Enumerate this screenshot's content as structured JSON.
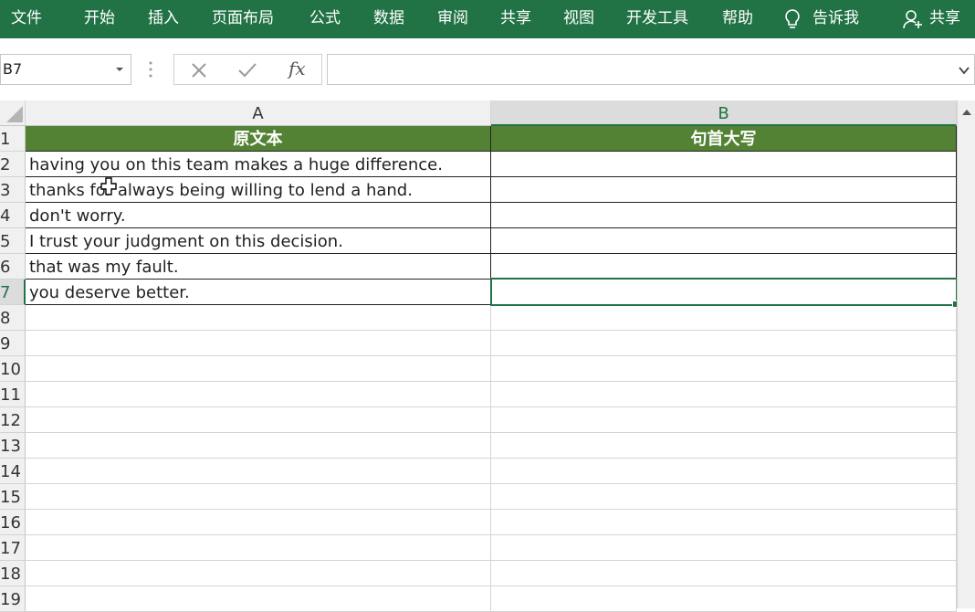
{
  "ribbon": {
    "tabs": [
      "文件",
      "开始",
      "插入",
      "页面布局",
      "公式",
      "数据",
      "审阅",
      "共享",
      "视图",
      "开发工具",
      "帮助"
    ],
    "tell_me": "告诉我",
    "share": "共享",
    "color": "#217346"
  },
  "formula_bar": {
    "name_box": "B7",
    "cancel_icon": "x-icon",
    "enter_icon": "check-icon",
    "function_label": "fx",
    "formula": ""
  },
  "sheet": {
    "columns": [
      "A",
      "B"
    ],
    "selected_column": "B",
    "rows": [
      "1",
      "2",
      "3",
      "4",
      "5",
      "6",
      "7",
      "8",
      "9",
      "10",
      "11",
      "12",
      "13",
      "14",
      "15",
      "16",
      "17",
      "18",
      "19"
    ],
    "selected_row": "7",
    "header_row": [
      "原文本",
      "句首大写"
    ],
    "header_fill": "#548235",
    "data": [
      [
        "having you on this team makes a huge difference.",
        ""
      ],
      [
        "thanks for always being willing to lend a hand.",
        ""
      ],
      [
        "don't worry.",
        ""
      ],
      [
        "I trust your judgment on this decision.",
        ""
      ],
      [
        "that was my fault.",
        ""
      ],
      [
        "you deserve better.",
        ""
      ]
    ],
    "active_cell": "B7"
  }
}
